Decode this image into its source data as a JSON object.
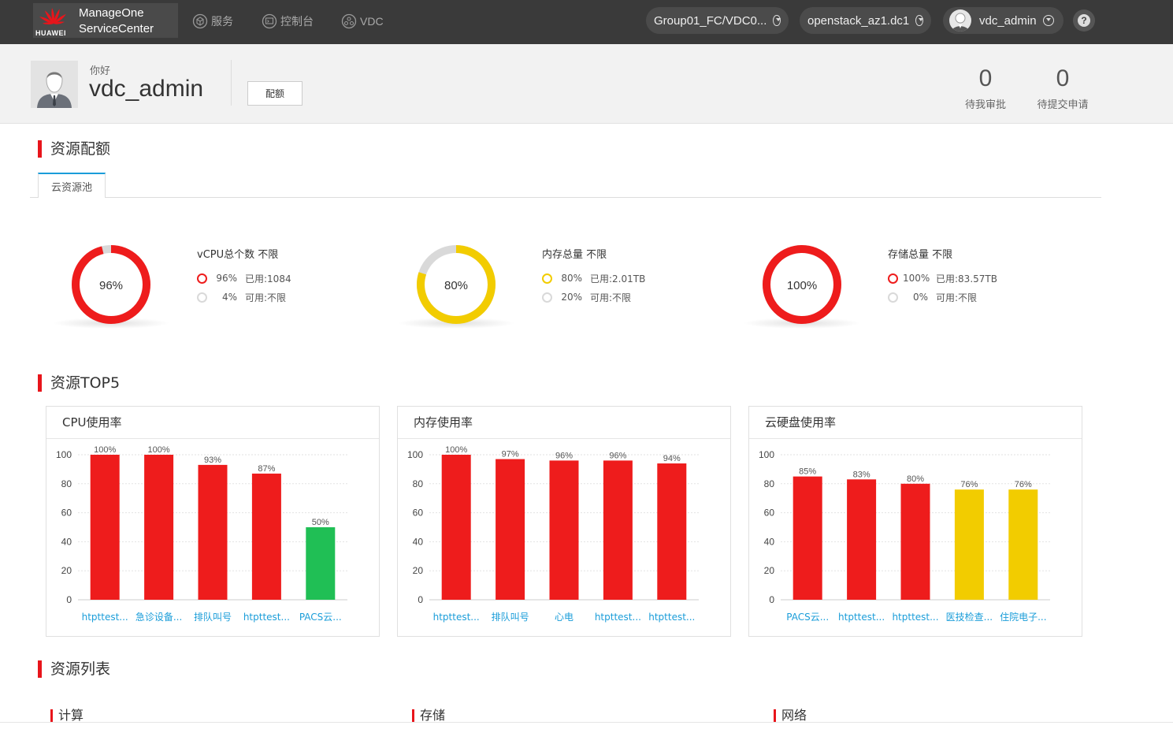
{
  "header": {
    "logo_title_line1": "ManageOne",
    "logo_title_line2": "ServiceCenter",
    "logo_brand": "HUAWEI",
    "nav": [
      {
        "label": "服务",
        "icon": "cube-icon"
      },
      {
        "label": "控制台",
        "icon": "console-icon"
      },
      {
        "label": "VDC",
        "icon": "vdc-icon"
      }
    ],
    "vdc_selector": "Group01_FC/VDC0...",
    "region_selector": "openstack_az1.dc1",
    "user": "vdc_admin",
    "help": "?"
  },
  "profile": {
    "greeting": "你好",
    "username": "vdc_admin",
    "quota_button": "配额",
    "stats": [
      {
        "value": "0",
        "label": "待我审批"
      },
      {
        "value": "0",
        "label": "待提交申请"
      }
    ]
  },
  "quota_section": {
    "title": "资源配额",
    "tab": "云资源池",
    "colors": {
      "red": "#ee1c1c",
      "yellow": "#f2cc00",
      "grey": "#d9d9d9"
    },
    "donuts": [
      {
        "center": "96%",
        "used_fraction": 0.96,
        "color": "#ee1c1c",
        "title": "vCPU总个数 不限",
        "rows": [
          {
            "pct": "96%",
            "text": "已用:1084",
            "color": "#ee1c1c"
          },
          {
            "pct": "4%",
            "text": "可用:不限",
            "color": "#d9d9d9"
          }
        ]
      },
      {
        "center": "80%",
        "used_fraction": 0.8,
        "color": "#f2cc00",
        "title": "内存总量 不限",
        "rows": [
          {
            "pct": "80%",
            "text": "已用:2.01TB",
            "color": "#f2cc00"
          },
          {
            "pct": "20%",
            "text": "可用:不限",
            "color": "#d9d9d9"
          }
        ]
      },
      {
        "center": "100%",
        "used_fraction": 1.0,
        "color": "#ee1c1c",
        "title": "存储总量 不限",
        "rows": [
          {
            "pct": "100%",
            "text": "已用:83.57TB",
            "color": "#ee1c1c"
          },
          {
            "pct": "0%",
            "text": "可用:不限",
            "color": "#d9d9d9"
          }
        ]
      }
    ]
  },
  "top5_section": {
    "title": "资源TOP5"
  },
  "chart_data": [
    {
      "type": "bar",
      "title": "CPU使用率",
      "categories": [
        "htpttest...",
        "急诊设备...",
        "排队叫号",
        "htpttest...",
        "PACS云..."
      ],
      "values": [
        100,
        100,
        93,
        87,
        50
      ],
      "labels": [
        "100%",
        "100%",
        "93%",
        "87%",
        "50%"
      ],
      "colors": [
        "#ee1c1c",
        "#ee1c1c",
        "#ee1c1c",
        "#ee1c1c",
        "#20bf55"
      ],
      "yticks": [
        0,
        20,
        40,
        60,
        80,
        100
      ],
      "ylim": [
        0,
        100
      ]
    },
    {
      "type": "bar",
      "title": "内存使用率",
      "categories": [
        "htpttest...",
        "排队叫号",
        "心电",
        "htpttest...",
        "htpttest..."
      ],
      "values": [
        100,
        97,
        96,
        96,
        94
      ],
      "labels": [
        "100%",
        "97%",
        "96%",
        "96%",
        "94%"
      ],
      "colors": [
        "#ee1c1c",
        "#ee1c1c",
        "#ee1c1c",
        "#ee1c1c",
        "#ee1c1c"
      ],
      "yticks": [
        0,
        20,
        40,
        60,
        80,
        100
      ],
      "ylim": [
        0,
        100
      ]
    },
    {
      "type": "bar",
      "title": "云硬盘使用率",
      "categories": [
        "PACS云...",
        "htpttest...",
        "htpttest...",
        "医技检查...",
        "住院电子..."
      ],
      "values": [
        85,
        83,
        80,
        76,
        76
      ],
      "labels": [
        "85%",
        "83%",
        "80%",
        "76%",
        "76%"
      ],
      "colors": [
        "#ee1c1c",
        "#ee1c1c",
        "#ee1c1c",
        "#f2cc00",
        "#f2cc00"
      ],
      "yticks": [
        0,
        20,
        40,
        60,
        80,
        100
      ],
      "ylim": [
        0,
        100
      ]
    }
  ],
  "list_section": {
    "title": "资源列表",
    "columns": [
      "计算",
      "存储",
      "网络"
    ]
  }
}
